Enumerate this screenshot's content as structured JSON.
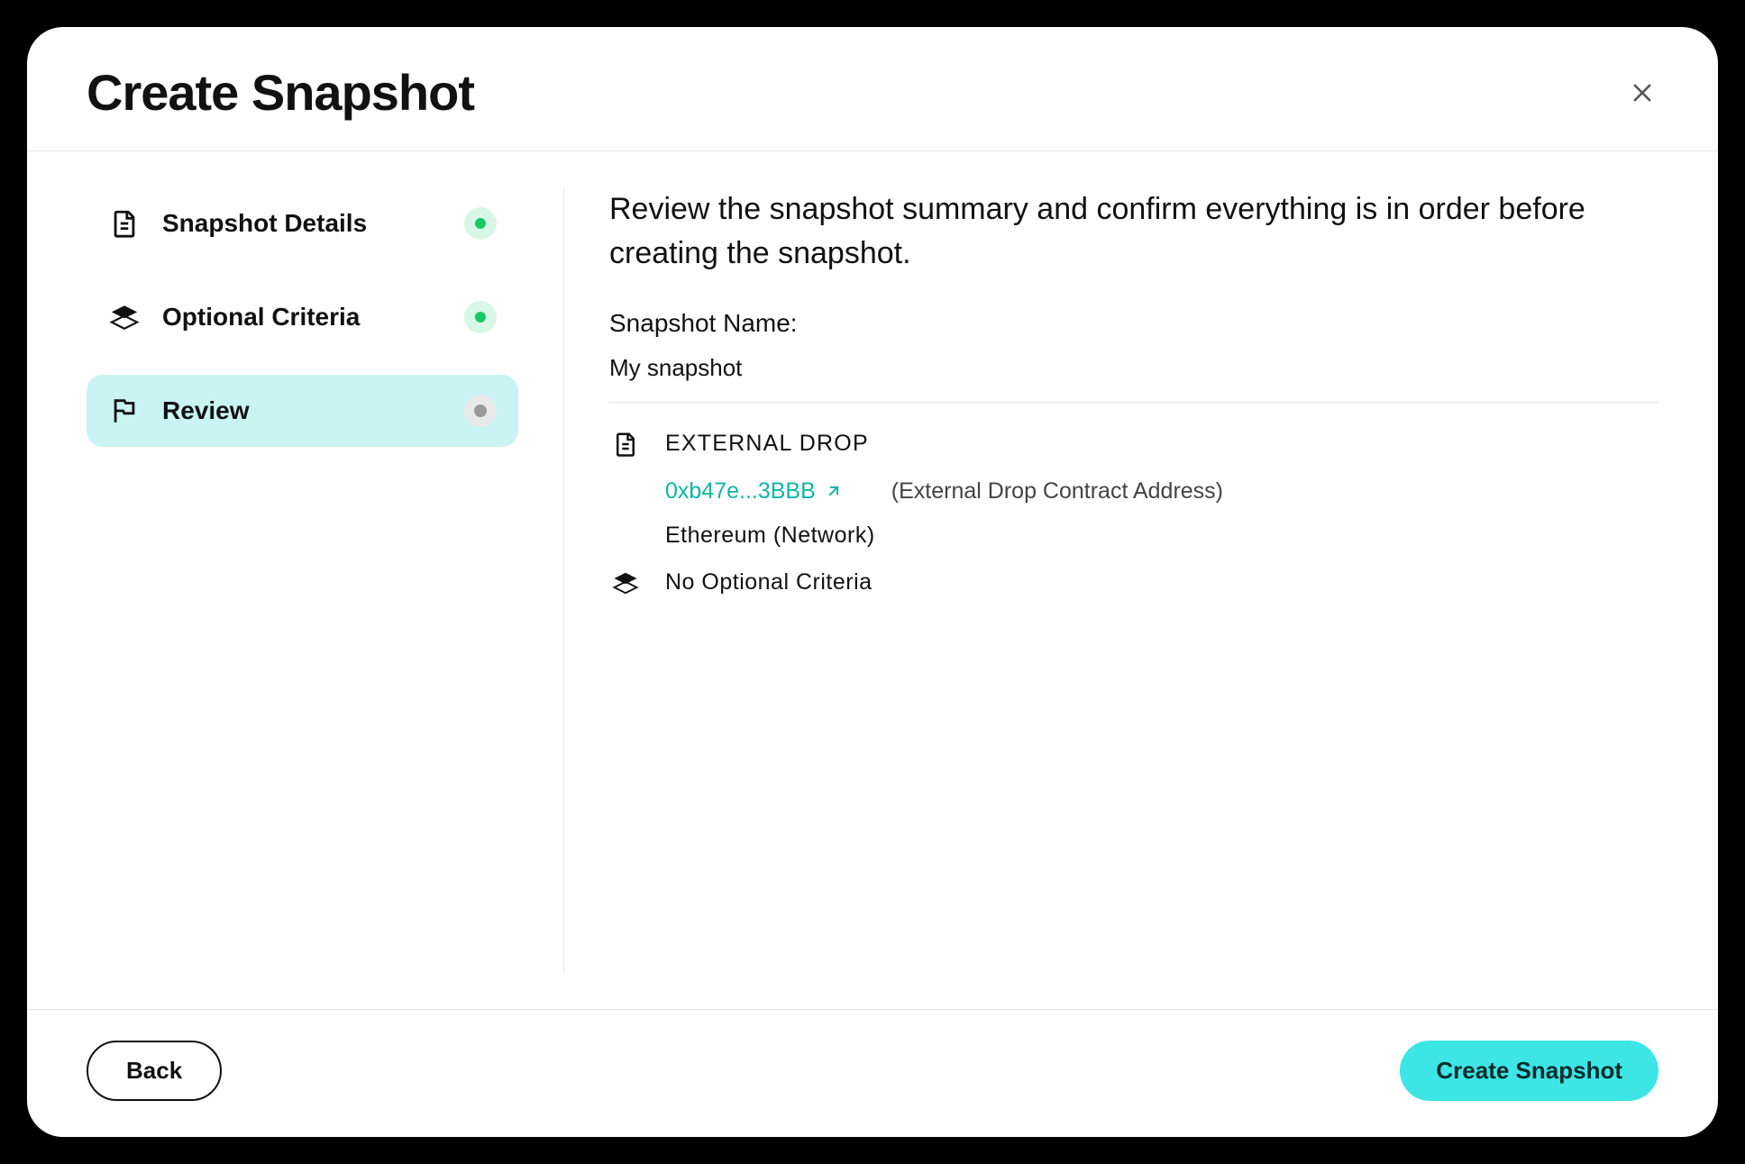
{
  "modal": {
    "title": "Create Snapshot"
  },
  "steps": [
    {
      "label": "Snapshot Details",
      "status": "done"
    },
    {
      "label": "Optional Criteria",
      "status": "done"
    },
    {
      "label": "Review",
      "status": "current"
    }
  ],
  "review": {
    "instruction": "Review the snapshot summary and confirm everything is in order before creating the snapshot.",
    "name_label": "Snapshot Name:",
    "name_value": "My snapshot",
    "external_drop_label": "EXTERNAL DROP",
    "contract_address": "0xb47e...3BBB",
    "contract_address_hint": "(External Drop Contract Address)",
    "network_line": "Ethereum (Network)",
    "optional_criteria_line": "No Optional Criteria"
  },
  "footer": {
    "back_label": "Back",
    "submit_label": "Create Snapshot"
  }
}
